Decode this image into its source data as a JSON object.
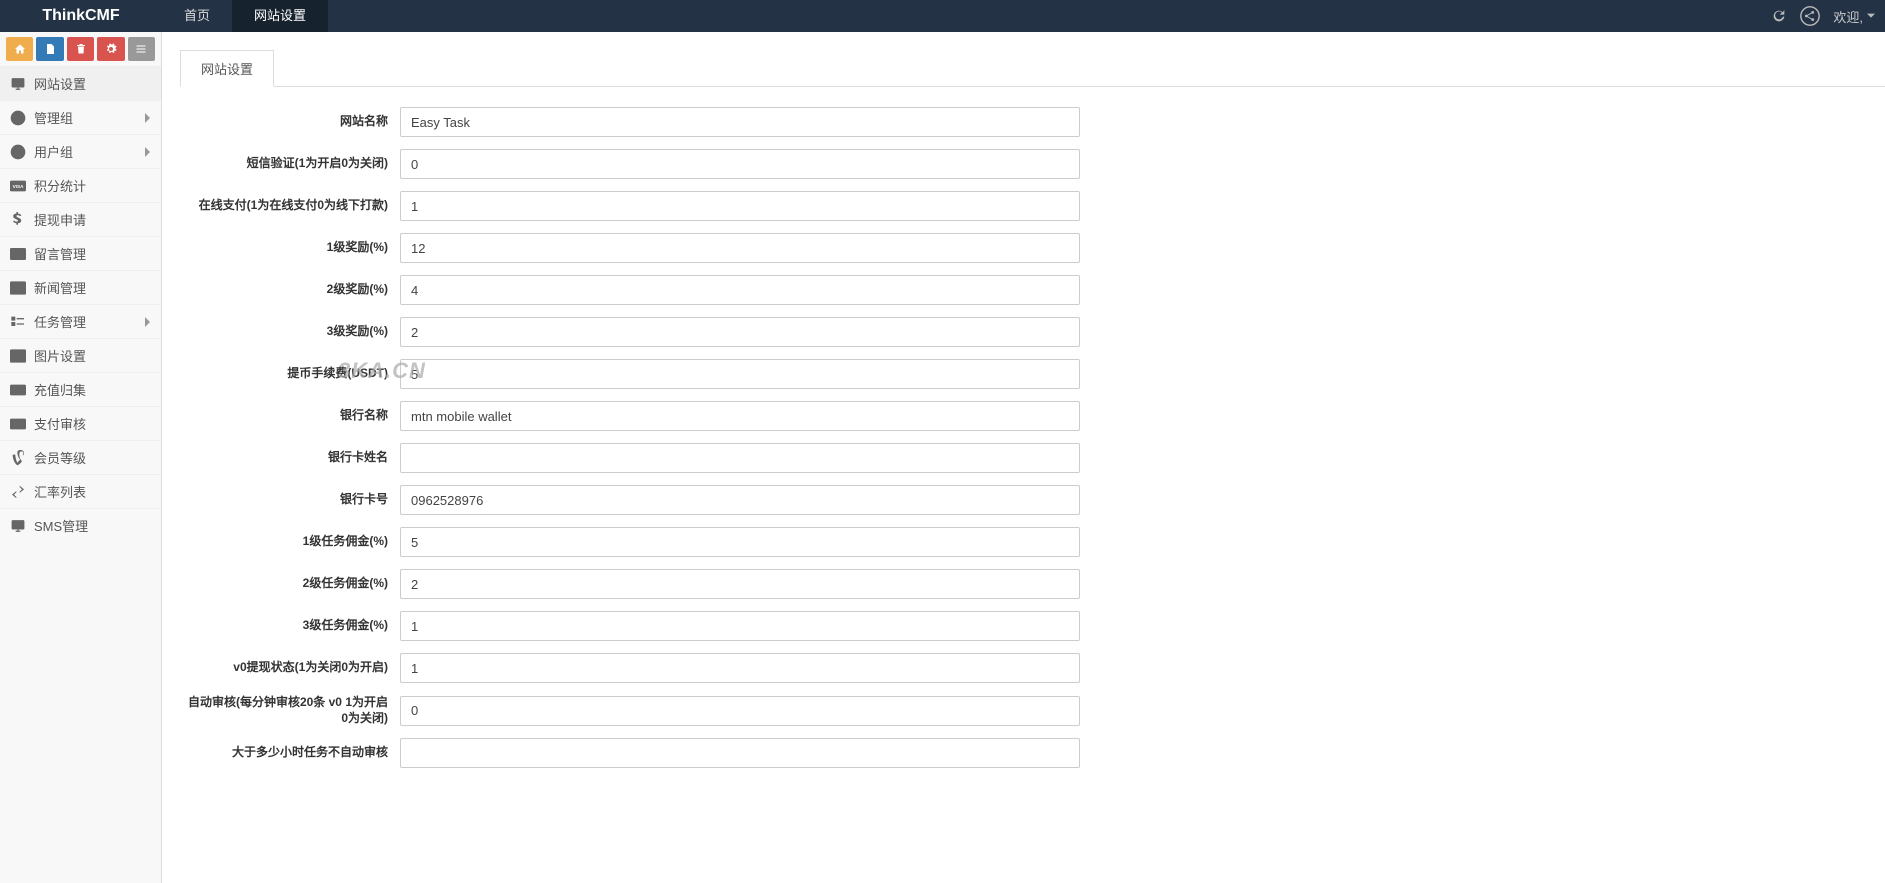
{
  "navbar": {
    "brand": "ThinkCMF",
    "tabs": [
      {
        "label": "首页",
        "active": false
      },
      {
        "label": "网站设置",
        "active": true
      }
    ],
    "welcome": "欢迎,"
  },
  "sidebar": {
    "items": [
      {
        "label": "网站设置",
        "icon": "display",
        "active": true,
        "expandable": false
      },
      {
        "label": "管理组",
        "icon": "user-circle",
        "active": false,
        "expandable": true
      },
      {
        "label": "用户组",
        "icon": "user-circle",
        "active": false,
        "expandable": true
      },
      {
        "label": "积分统计",
        "icon": "visa",
        "active": false,
        "expandable": false
      },
      {
        "label": "提现申请",
        "icon": "dollar",
        "active": false,
        "expandable": false
      },
      {
        "label": "留言管理",
        "icon": "envelope",
        "active": false,
        "expandable": false
      },
      {
        "label": "新闻管理",
        "icon": "news",
        "active": false,
        "expandable": false
      },
      {
        "label": "任务管理",
        "icon": "tasks",
        "active": false,
        "expandable": true
      },
      {
        "label": "图片设置",
        "icon": "image",
        "active": false,
        "expandable": false
      },
      {
        "label": "充值归集",
        "icon": "money",
        "active": false,
        "expandable": false
      },
      {
        "label": "支付审核",
        "icon": "card",
        "active": false,
        "expandable": false
      },
      {
        "label": "会员等级",
        "icon": "vine",
        "active": false,
        "expandable": false
      },
      {
        "label": "汇率列表",
        "icon": "exchange",
        "active": false,
        "expandable": false
      },
      {
        "label": "SMS管理",
        "icon": "display",
        "active": false,
        "expandable": false
      }
    ]
  },
  "page": {
    "tab_label": "网站设置",
    "fields": [
      {
        "label": "网站名称",
        "value": "Easy Task"
      },
      {
        "label": "短信验证(1为开启0为关闭)",
        "value": "0"
      },
      {
        "label": "在线支付(1为在线支付0为线下打款)",
        "value": "1"
      },
      {
        "label": "1级奖励(%)",
        "value": "12"
      },
      {
        "label": "2级奖励(%)",
        "value": "4"
      },
      {
        "label": "3级奖励(%)",
        "value": "2"
      },
      {
        "label": "提币手续费(USDT)",
        "value": "5"
      },
      {
        "label": "银行名称",
        "value": "mtn mobile wallet"
      },
      {
        "label": "银行卡姓名",
        "value": ""
      },
      {
        "label": "银行卡号",
        "value": "0962528976"
      },
      {
        "label": "1级任务佣金(%)",
        "value": "5"
      },
      {
        "label": "2级任务佣金(%)",
        "value": "2"
      },
      {
        "label": "3级任务佣金(%)",
        "value": "1"
      },
      {
        "label": "v0提现状态(1为关闭0为开启)",
        "value": "1"
      },
      {
        "label": "自动审核(每分钟审核20条 v0 1为开启 0为关闭)",
        "value": "0"
      },
      {
        "label": "大于多少小时任务不自动审核",
        "value": ""
      }
    ]
  },
  "watermark": "3KA.CN"
}
